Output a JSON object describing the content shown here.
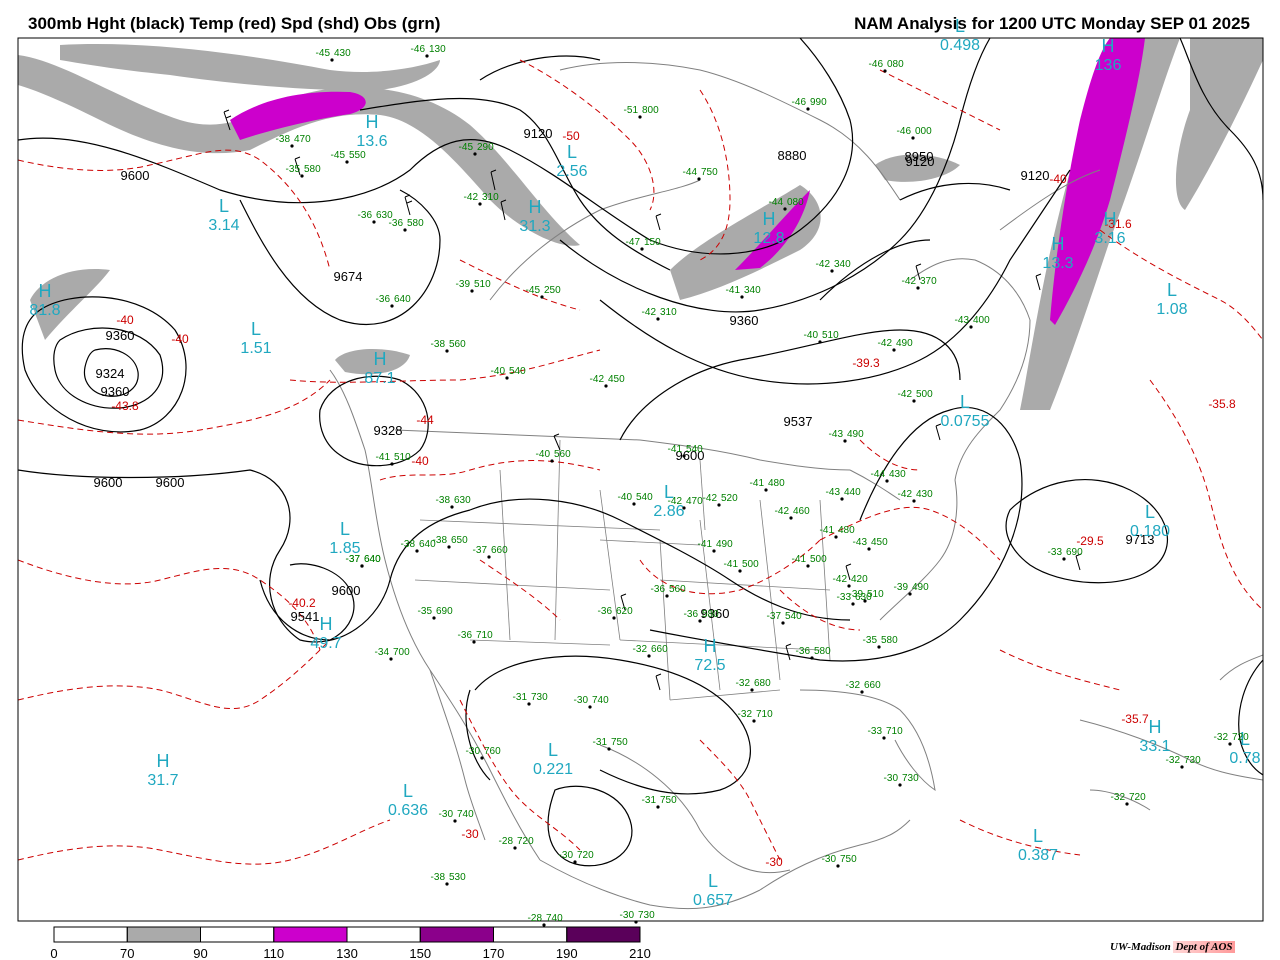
{
  "header": {
    "title_left": "300mb Hght (black) Temp (red) Spd (shd) Obs (grn)",
    "title_right": "NAM Analysis for 1200 UTC Monday  SEP 01 2025"
  },
  "colors": {
    "height": "#000000",
    "temp": "#cc0000",
    "obs": "#008000",
    "pressure_center": "#20a8c0",
    "borders": "#808080",
    "speed_70_90": "#aaaaaa",
    "speed_110_130": "#cc00cc",
    "speed_150_170": "#8b008b",
    "speed_190_210": "#5a005a"
  },
  "legend": {
    "ticks": [
      "0",
      "70",
      "90",
      "110",
      "130",
      "150",
      "170",
      "190",
      "210"
    ],
    "shaded": [
      {
        "from": "70",
        "to": "90",
        "color": "#aaaaaa"
      },
      {
        "from": "110",
        "to": "130",
        "color": "#cc00cc"
      },
      {
        "from": "150",
        "to": "170",
        "color": "#8b008b"
      },
      {
        "from": "190",
        "to": "210",
        "color": "#5a005a"
      }
    ]
  },
  "credit": {
    "org": "UW-Madison",
    "dept": "Dept of AOS"
  },
  "height_labels": [
    "9600",
    "9674",
    "9360",
    "9324",
    "9360",
    "9328",
    "9600",
    "9541",
    "9600",
    "9360",
    "9120",
    "8880",
    "9120",
    "9537",
    "9360",
    "9600",
    "9600",
    "9713",
    "9120",
    "8950"
  ],
  "temp_labels": [
    "-40",
    "-40",
    "-43.8",
    "-44",
    "-40",
    "-40.2",
    "-39.3",
    "-29.5",
    "-35.8",
    "-35.7",
    "-30",
    "-30",
    "-31.6",
    "-40",
    "-50"
  ],
  "center_labels": [
    {
      "letter": "L",
      "value": "3.14"
    },
    {
      "letter": "L",
      "value": "1.51"
    },
    {
      "letter": "H",
      "value": "81.8"
    },
    {
      "letter": "H",
      "value": "87.1"
    },
    {
      "letter": "L",
      "value": "1.85"
    },
    {
      "letter": "H",
      "value": "49.7"
    },
    {
      "letter": "H",
      "value": "31.7"
    },
    {
      "letter": "L",
      "value": "0.636"
    },
    {
      "letter": "L",
      "value": "0.221"
    },
    {
      "letter": "L",
      "value": "2.86"
    },
    {
      "letter": "H",
      "value": "72.5"
    },
    {
      "letter": "L",
      "value": "0.657"
    },
    {
      "letter": "L",
      "value": "0.387"
    },
    {
      "letter": "H",
      "value": "33.1"
    },
    {
      "letter": "L",
      "value": "1.08"
    },
    {
      "letter": "L",
      "value": "0.180"
    },
    {
      "letter": "H",
      "value": "13.6"
    },
    {
      "letter": "L",
      "value": "2.56"
    },
    {
      "letter": "H",
      "value": "31.3"
    },
    {
      "letter": "H",
      "value": "13.3"
    },
    {
      "letter": "L",
      "value": "0.498"
    },
    {
      "letter": "H",
      "value": "136"
    },
    {
      "letter": "H",
      "value": "12.8"
    },
    {
      "letter": "L",
      "value": "0.0755"
    },
    {
      "letter": "H",
      "value": "3.16"
    },
    {
      "letter": "L",
      "value": "0.78"
    }
  ],
  "observations": [
    {
      "t": "-45",
      "h": "430"
    },
    {
      "t": "-46",
      "h": "130"
    },
    {
      "t": "-38",
      "h": "470"
    },
    {
      "t": "-45",
      "h": "550"
    },
    {
      "t": "-35",
      "h": "580"
    },
    {
      "t": "-36",
      "h": "630"
    },
    {
      "t": "-45",
      "h": "290"
    },
    {
      "t": "-42",
      "h": "310"
    },
    {
      "t": "-36",
      "h": "580"
    },
    {
      "t": "-39",
      "h": "510"
    },
    {
      "t": "-45",
      "h": "250"
    },
    {
      "t": "-36",
      "h": "640"
    },
    {
      "t": "-38",
      "h": "560"
    },
    {
      "t": "-40",
      "h": "540"
    },
    {
      "t": "-42",
      "h": "450"
    },
    {
      "t": "-41",
      "h": "510"
    },
    {
      "t": "-40",
      "h": "560"
    },
    {
      "t": "-41",
      "h": "540"
    },
    {
      "t": "-40",
      "h": "540"
    },
    {
      "t": "-38",
      "h": "630"
    },
    {
      "t": "-38",
      "h": "640"
    },
    {
      "t": "-37",
      "h": "640"
    },
    {
      "t": "-38",
      "h": "650"
    },
    {
      "t": "-37",
      "h": "660"
    },
    {
      "t": "-37",
      "h": "640"
    },
    {
      "t": "-35",
      "h": "690"
    },
    {
      "t": "-36",
      "h": "710"
    },
    {
      "t": "-34",
      "h": "700"
    },
    {
      "t": "-31",
      "h": "730"
    },
    {
      "t": "-30",
      "h": "740"
    },
    {
      "t": "-36",
      "h": "620"
    },
    {
      "t": "-32",
      "h": "660"
    },
    {
      "t": "-36",
      "h": "560"
    },
    {
      "t": "-36",
      "h": "580"
    },
    {
      "t": "-37",
      "h": "540"
    },
    {
      "t": "-33",
      "h": "630"
    },
    {
      "t": "-32",
      "h": "680"
    },
    {
      "t": "-32",
      "h": "710"
    },
    {
      "t": "-36",
      "h": "580"
    },
    {
      "t": "-35",
      "h": "580"
    },
    {
      "t": "-32",
      "h": "660"
    },
    {
      "t": "-33",
      "h": "710"
    },
    {
      "t": "-31",
      "h": "750"
    },
    {
      "t": "-31",
      "h": "750"
    },
    {
      "t": "-30",
      "h": "760"
    },
    {
      "t": "-30",
      "h": "740"
    },
    {
      "t": "-28",
      "h": "720"
    },
    {
      "t": "-30",
      "h": "720"
    },
    {
      "t": "-30",
      "h": "730"
    },
    {
      "t": "-30",
      "h": "750"
    },
    {
      "t": "-30",
      "h": "730"
    },
    {
      "t": "-33",
      "h": "690"
    },
    {
      "t": "-32",
      "h": "730"
    },
    {
      "t": "-32",
      "h": "720"
    },
    {
      "t": "-32",
      "h": "720"
    },
    {
      "t": "-28",
      "h": "740"
    },
    {
      "t": "-46",
      "h": "080"
    },
    {
      "t": "-46",
      "h": "000"
    },
    {
      "t": "-46",
      "h": "990"
    },
    {
      "t": "-51",
      "h": "800"
    },
    {
      "t": "-44",
      "h": "750"
    },
    {
      "t": "-47",
      "h": "150"
    },
    {
      "t": "-44",
      "h": "080"
    },
    {
      "t": "-42",
      "h": "340"
    },
    {
      "t": "-41",
      "h": "340"
    },
    {
      "t": "-42",
      "h": "310"
    },
    {
      "t": "-42",
      "h": "370"
    },
    {
      "t": "-43",
      "h": "400"
    },
    {
      "t": "-40",
      "h": "510"
    },
    {
      "t": "-42",
      "h": "490"
    },
    {
      "t": "-42",
      "h": "500"
    },
    {
      "t": "-43",
      "h": "490"
    },
    {
      "t": "-44",
      "h": "430"
    },
    {
      "t": "-43",
      "h": "440"
    },
    {
      "t": "-42",
      "h": "430"
    },
    {
      "t": "-41",
      "h": "480"
    },
    {
      "t": "-42",
      "h": "460"
    },
    {
      "t": "-42",
      "h": "470"
    },
    {
      "t": "-42",
      "h": "520"
    },
    {
      "t": "-41",
      "h": "490"
    },
    {
      "t": "-41",
      "h": "500"
    },
    {
      "t": "-41",
      "h": "500"
    },
    {
      "t": "-41",
      "h": "480"
    },
    {
      "t": "-43",
      "h": "450"
    },
    {
      "t": "-42",
      "h": "420"
    },
    {
      "t": "-39",
      "h": "490"
    },
    {
      "t": "-39",
      "h": "510"
    },
    {
      "t": "-38",
      "h": "530"
    }
  ]
}
